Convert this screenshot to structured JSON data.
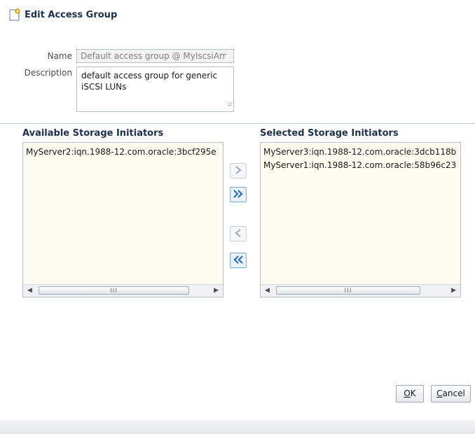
{
  "dialog": {
    "title": "Edit Access Group"
  },
  "form": {
    "name_label": "Name",
    "name_value": "Default access group @ MyIscsiArr",
    "description_label": "Description",
    "description_line1": "default access group for generic",
    "description_line2": "iSCSI LUNs"
  },
  "available": {
    "header": "Available Storage Initiators",
    "items": [
      "MyServer2:iqn.1988-12.com.oracle:3bcf295e"
    ]
  },
  "selected": {
    "header": "Selected Storage Initiators",
    "items": [
      "MyServer3:iqn.1988-12.com.oracle:3dcb118b",
      "MyServer1:iqn.1988-12.com.oracle:58b96c23"
    ]
  },
  "shuttle": {
    "move_icon": "chevron-right-icon",
    "move_all_icon": "double-chevron-right-icon",
    "remove_icon": "chevron-left-icon",
    "remove_all_icon": "double-chevron-left-icon"
  },
  "buttons": {
    "ok_mnemonic": "O",
    "ok_rest": "K",
    "cancel_mnemonic": "C",
    "cancel_rest": "ancel"
  },
  "scrollbar": {
    "grip": "III",
    "left_arrow": "◀",
    "right_arrow": "▶"
  },
  "colors": {
    "title": "#1e2f4d",
    "list_background": "#fcfdf0",
    "shuttle_active": "#2e6db4",
    "shuttle_disabled": "#9aa8b8"
  }
}
